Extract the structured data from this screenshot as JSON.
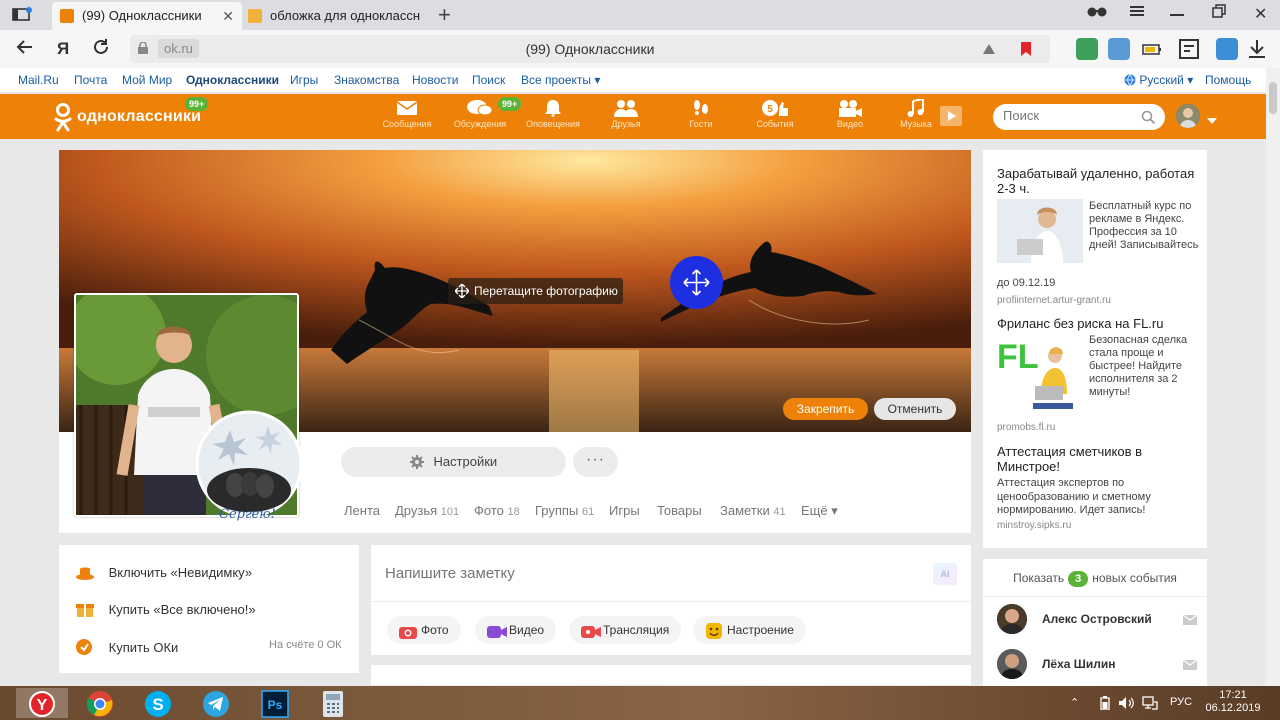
{
  "browser": {
    "tabs": [
      {
        "title": "(99) Одноклассники",
        "favicon_color": "#ee8208"
      },
      {
        "title": "обложка для одноклассн",
        "favicon_color": "#f2b03a"
      }
    ],
    "domain": "ok.ru",
    "page_title": "(99) Одноклассники",
    "brand_letter": "Я"
  },
  "toplinks": {
    "items": [
      "Mail.Ru",
      "Почта",
      "Мой Мир",
      "Одноклассники",
      "Игры",
      "Знакомства",
      "Новости",
      "Поиск",
      "Все проекты ▾"
    ],
    "language": "Русский ▾",
    "help": "Помощь"
  },
  "header": {
    "logo_text": "одноклассники",
    "logo_badge": "99+",
    "nav": [
      {
        "label": "Сообщения",
        "icon": "envelope-icon"
      },
      {
        "label": "Обсуждения",
        "icon": "chat-bubbles-icon",
        "badge": "99+"
      },
      {
        "label": "Оповещения",
        "icon": "bell-icon"
      },
      {
        "label": "Друзья",
        "icon": "friends-icon"
      },
      {
        "label": "Гости",
        "icon": "footprints-icon"
      },
      {
        "label": "События",
        "icon": "events-icon"
      },
      {
        "label": "Видео",
        "icon": "video-camera-icon"
      },
      {
        "label": "Музыка",
        "icon": "music-note-icon"
      }
    ],
    "search_placeholder": "Поиск"
  },
  "cover": {
    "drag_hint": "Перетащите фотографию",
    "pin_label": "Закрепить",
    "cancel_label": "Отменить"
  },
  "profile": {
    "sticker_text": "Сергею!",
    "settings_label": "Настройки",
    "more_label": "···",
    "tabs": [
      {
        "label": "Лента",
        "count": ""
      },
      {
        "label": "Друзья",
        "count": "101"
      },
      {
        "label": "Фото",
        "count": "18"
      },
      {
        "label": "Группы",
        "count": "61"
      },
      {
        "label": "Игры",
        "count": ""
      },
      {
        "label": "Товары",
        "count": ""
      },
      {
        "label": "Заметки",
        "count": "41"
      },
      {
        "label": "Ещё ▾",
        "count": ""
      }
    ]
  },
  "left_panel": {
    "items": [
      "Включить «Невидимку»",
      "Купить «Все включено!»",
      "Купить ОКи"
    ],
    "balance": "На счёте 0 ОК"
  },
  "post": {
    "placeholder": "Напишите заметку",
    "ai_badge": "AI",
    "buttons": [
      "Фото",
      "Видео",
      "Трансляция",
      "Настроение"
    ]
  },
  "ads": [
    {
      "title": "Зарабатывай удаленно, работая 2-3 ч.",
      "text": "Бесплатный курс по рекламе в Яндекс. Профессия за 10 дней! Записывайтесь",
      "tail": "до 09.12.19",
      "url": "profiinternet.artur-grant.ru"
    },
    {
      "title": "Фриланс без риска на FL.ru",
      "text": "Безопасная сделка стала проще и быстрее! Найдите исполнителя за 2 минуты!",
      "logo": "FL",
      "url": "promobs.fl.ru"
    },
    {
      "title": "Аттестация сметчиков в Минстрое!",
      "text": "Аттестация экспертов по ценообразованию и сметному нормированию. Идет запись!",
      "url": "minstroy.sipks.ru"
    }
  ],
  "events": {
    "show_label": "Показать",
    "count": "3",
    "tail_label": "новых события",
    "friends": [
      "Алекс Островский",
      "Лёха Шилин"
    ]
  },
  "taskbar": {
    "lang": "РУС",
    "time": "17:21",
    "date": "06.12.2019",
    "ps_label": "Ps"
  }
}
